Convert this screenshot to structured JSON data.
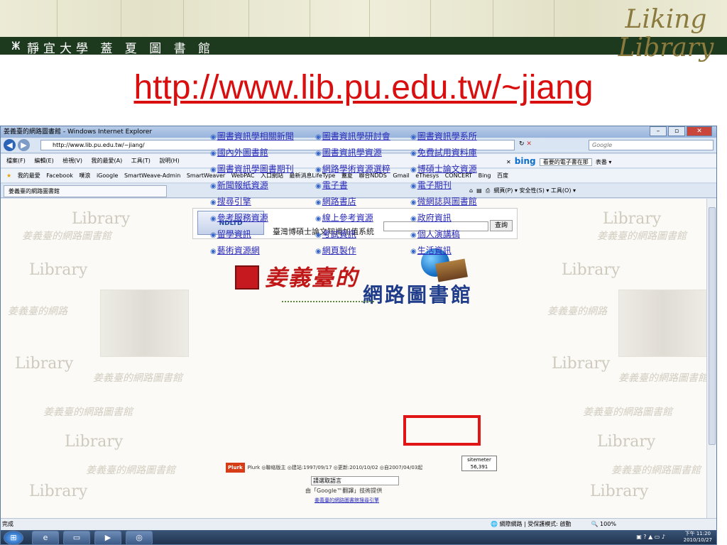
{
  "slide": {
    "library_name": "靜宜大學 蓋 夏 圖 書 館",
    "logo_line1": "Liking",
    "logo_line2": "Library",
    "url_title": "http://www.lib.pu.edu.tw/~jiang"
  },
  "browser": {
    "window_title": "姜義臺的網路圖書館 - Windows Internet Explorer",
    "address": "http://www.lib.pu.edu.tw/~jiang/",
    "search_placeholder": "Google",
    "menu": [
      "檔案(F)",
      "編輯(E)",
      "檢視(V)",
      "我的最愛(A)",
      "工具(T)",
      "說明(H)"
    ],
    "toolbar_search_text": "看要的電子書在那",
    "bing_label": "bing",
    "toolbar_right": "表番 ▾",
    "favorites_label": "我的最愛",
    "favorites": [
      "Facebook",
      "噗浪",
      "iGoogle",
      "SmartWeave-Admin",
      "SmartWeaver",
      "WebPAC",
      "入口網站",
      "最新消息LifeType",
      "蓋夏",
      "聯合NDDS",
      "Gmail",
      "eThesys",
      "CONCERT",
      "Bing",
      "百度"
    ],
    "tab_title": "姜義臺的網路圖書館",
    "command_bar": "網頁(P) ▾  安全性(S) ▾  工具(O) ▾",
    "status_text": "完成",
    "status_zone": "網際網路 | 受保護模式: 啟動",
    "zoom": "100%"
  },
  "page": {
    "ndltd_logo": "NDLTD",
    "ndltd_title": "臺灣博碩士論文知識加值系統",
    "ndltd_button": "查詢",
    "banner_title_1": "姜義臺的",
    "banner_title_2": "網路圖書館",
    "links_col1": [
      "圖書資訊學相關新聞",
      "國內外圖書館",
      "圖書資訊學圖書期刊",
      "新聞報紙資源",
      "搜尋引擎",
      "參考服務資源",
      "留學資訊",
      "藝術資源網"
    ],
    "links_col2": [
      "圖書資訊學研討會",
      "圖書資訊學資源",
      "網路學術資源選粹",
      "電子書",
      "網路書店",
      "線上參考資源",
      "考試資訊",
      "網頁製作"
    ],
    "links_col3": [
      "圖書資訊學系所",
      "免費試用資料庫",
      "博碩士論文資源",
      "電子期刊",
      "微網誌與圖書館",
      "政府資訊",
      "個人演講稿",
      "生活資訊"
    ],
    "footer_links": "Plurk  ◎聯絡版主  ◎建站:1997/09/17  ◎更新:2010/10/02  ◎自2007/04/03起",
    "counter_label": "sitemeter",
    "counter_value": "56,391",
    "language_select": "請選取語言",
    "translate_text": "由「Google™翻譯」技術提供",
    "translate_link": "姜義臺的網路圖書館搜尋引擎"
  },
  "taskbar": {
    "time": "下午 11:20",
    "date": "2010/10/27"
  },
  "colors": {
    "url_red": "#d90f0f",
    "highlight_red": "#e01515",
    "band_green": "#1d3a1e",
    "link_blue": "#2a2ab8"
  }
}
